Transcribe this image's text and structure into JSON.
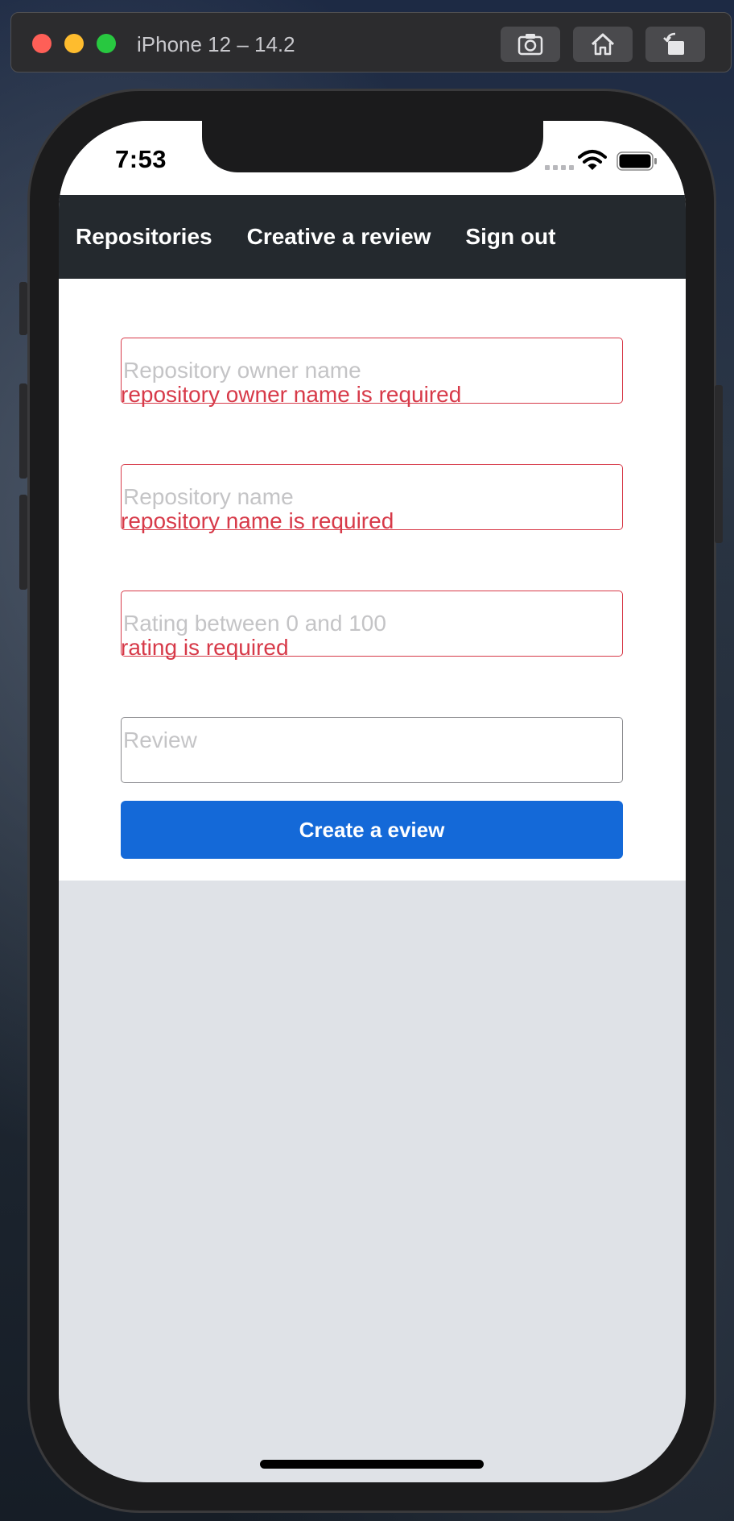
{
  "simulator": {
    "title": "iPhone 12 – 14.2",
    "buttons": [
      "screenshot-icon",
      "home-icon",
      "rotate-icon"
    ]
  },
  "status_bar": {
    "time": "7:53"
  },
  "nav": {
    "items": [
      {
        "label": "Repositories"
      },
      {
        "label": "Creative a review"
      },
      {
        "label": "Sign out"
      }
    ]
  },
  "form": {
    "owner": {
      "placeholder": "Repository owner name",
      "value": "",
      "error": "repository owner name is required"
    },
    "repo": {
      "placeholder": "Repository name",
      "value": "",
      "error": "repository name is required"
    },
    "rating": {
      "placeholder": "Rating between 0 and 100",
      "value": "",
      "error": "rating is required"
    },
    "review": {
      "placeholder": "Review",
      "value": ""
    },
    "submit_label": "Create a eview"
  },
  "colors": {
    "nav_bg": "#24292e",
    "error": "#d73a49",
    "primary": "#1469d8",
    "page_bg": "#dfe2e7"
  }
}
